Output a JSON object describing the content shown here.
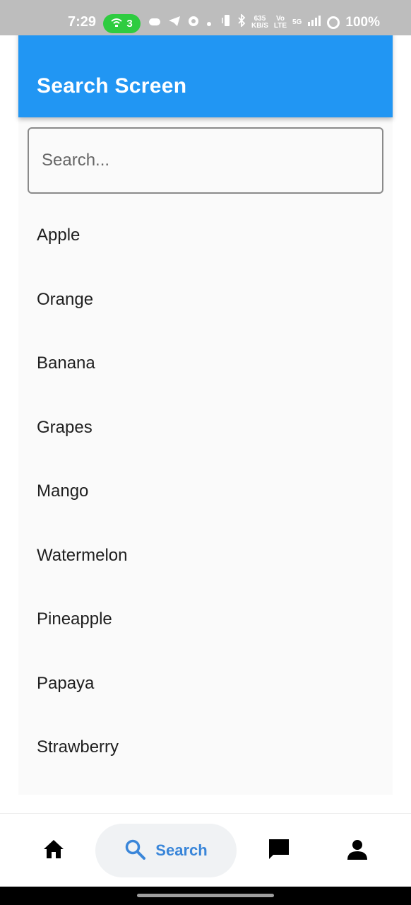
{
  "status_bar": {
    "time": "7:29",
    "hotspot_count": "3",
    "net_speed_value": "635",
    "net_speed_unit": "KB/S",
    "volte_top": "Vo",
    "volte_bottom": "LTE",
    "network_type": "5G",
    "battery": "100%"
  },
  "app_bar": {
    "title": "Search Screen",
    "color": "#2196f3"
  },
  "search": {
    "placeholder": "Search...",
    "value": ""
  },
  "fruits": [
    "Apple",
    "Orange",
    "Banana",
    "Grapes",
    "Mango",
    "Watermelon",
    "Pineapple",
    "Papaya",
    "Strawberry"
  ],
  "bottom_nav": {
    "items": [
      {
        "id": "home",
        "icon": "home-icon"
      },
      {
        "id": "search",
        "icon": "search-icon",
        "label": "Search",
        "selected": true
      },
      {
        "id": "messages",
        "icon": "chat-icon"
      },
      {
        "id": "profile",
        "icon": "person-icon"
      }
    ],
    "active_color": "#3a86d9"
  }
}
